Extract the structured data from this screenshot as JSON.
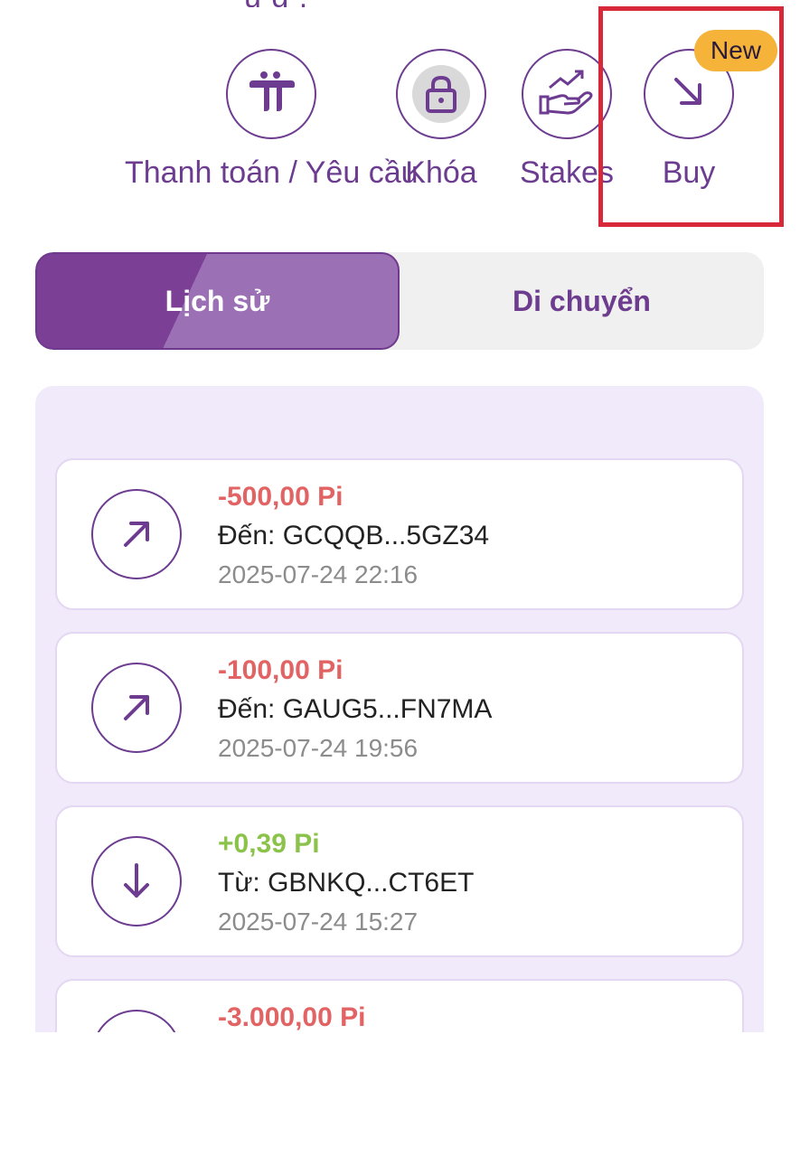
{
  "header": {
    "fragment": "ụ g   ,"
  },
  "actions": [
    {
      "label": "Thanh toán / Yêu cầu",
      "icon": "pi-logo-icon"
    },
    {
      "label": "Khóa",
      "icon": "lock-icon"
    },
    {
      "label": "Stakes",
      "icon": "stake-hand-icon"
    },
    {
      "label": "Buy",
      "icon": "arrow-down-right-icon",
      "badge": "New"
    }
  ],
  "tabs": {
    "history": "Lịch sử",
    "migration": "Di chuyển",
    "selected": "history"
  },
  "transactions": [
    {
      "amount": "-500,00 Pi",
      "party": "Đến: GCQQB...5GZ34",
      "date": "2025-07-24 22:16",
      "direction": "outgoing"
    },
    {
      "amount": "-100,00 Pi",
      "party": "Đến: GAUG5...FN7MA",
      "date": "2025-07-24 19:56",
      "direction": "outgoing"
    },
    {
      "amount": "+0,39 Pi",
      "party": "Từ: GBNKQ...CT6ET",
      "date": "2025-07-24 15:27",
      "direction": "incoming"
    },
    {
      "amount": "-3.000,00 Pi",
      "party": "",
      "date": "",
      "direction": "outgoing"
    }
  ],
  "colors": {
    "accent": "#6d3c91",
    "negative": "#e26363",
    "positive": "#8bc34a",
    "badge": "#f6b33a",
    "highlight": "#d8293a"
  }
}
